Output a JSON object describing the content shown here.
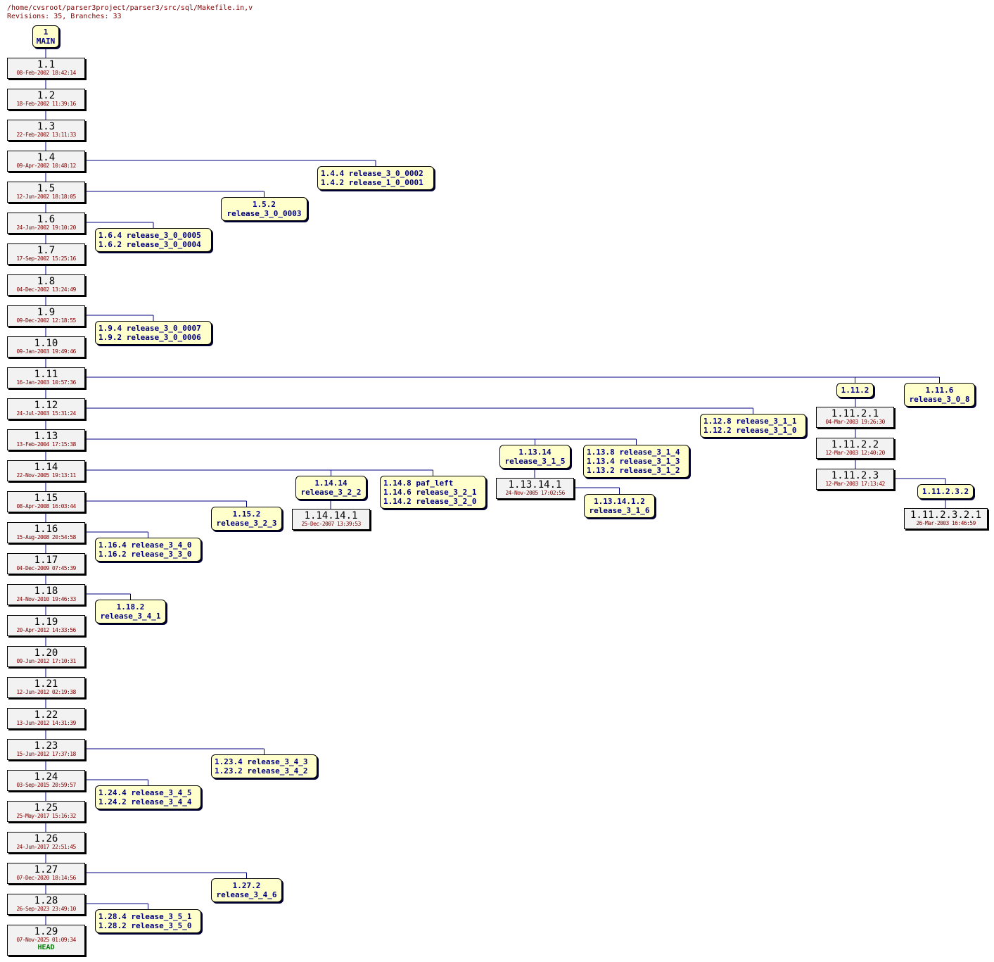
{
  "header": {
    "path": "/home/cvsroot/parser3project/parser3/src/sql/Makefile.in,v",
    "summary": "Revisions: 35, Branches: 33"
  },
  "colors": {
    "line": "#000080",
    "branch_bg": "#ffffcc",
    "branch_text": "#000080",
    "rev_bg": "#f2f2f2",
    "date": "#800000",
    "head": "#008000"
  },
  "root": {
    "num": "1",
    "name": "MAIN"
  },
  "revisions": [
    {
      "num": "1.1",
      "date": "08-Feb-2002 18:42:14"
    },
    {
      "num": "1.2",
      "date": "18-Feb-2002 11:39:16"
    },
    {
      "num": "1.3",
      "date": "22-Feb-2002 13:11:33"
    },
    {
      "num": "1.4",
      "date": "09-Apr-2002 10:48:12"
    },
    {
      "num": "1.5",
      "date": "12-Jun-2002 18:18:05"
    },
    {
      "num": "1.6",
      "date": "24-Jun-2002 19:10:20"
    },
    {
      "num": "1.7",
      "date": "17-Sep-2002 15:25:16"
    },
    {
      "num": "1.8",
      "date": "04-Dec-2002 13:24:49"
    },
    {
      "num": "1.9",
      "date": "09-Dec-2002 12:18:55"
    },
    {
      "num": "1.10",
      "date": "09-Jan-2003 19:49:46"
    },
    {
      "num": "1.11",
      "date": "16-Jan-2003 10:57:36"
    },
    {
      "num": "1.12",
      "date": "24-Jul-2003 15:31:24"
    },
    {
      "num": "1.13",
      "date": "13-Feb-2004 17:15:38"
    },
    {
      "num": "1.14",
      "date": "22-Nov-2005 19:13:11"
    },
    {
      "num": "1.15",
      "date": "08-Apr-2008 16:03:44"
    },
    {
      "num": "1.16",
      "date": "15-Aug-2008 20:54:58"
    },
    {
      "num": "1.17",
      "date": "04-Dec-2009 07:45:39"
    },
    {
      "num": "1.18",
      "date": "24-Nov-2010 19:46:33"
    },
    {
      "num": "1.19",
      "date": "20-Apr-2012 14:33:56"
    },
    {
      "num": "1.20",
      "date": "09-Jun-2012 17:10:31"
    },
    {
      "num": "1.21",
      "date": "12-Jun-2012 02:19:38"
    },
    {
      "num": "1.22",
      "date": "13-Jun-2012 14:31:39"
    },
    {
      "num": "1.23",
      "date": "15-Jun-2012 17:37:18"
    },
    {
      "num": "1.24",
      "date": "03-Sep-2015 20:59:57"
    },
    {
      "num": "1.25",
      "date": "25-May-2017 15:16:32"
    },
    {
      "num": "1.26",
      "date": "24-Jun-2017 22:51:45"
    },
    {
      "num": "1.27",
      "date": "07-Dec-2020 18:14:56"
    },
    {
      "num": "1.28",
      "date": "26-Sep-2023 23:49:10"
    },
    {
      "num": "1.29",
      "date": "07-Nov-2025 01:09:34",
      "tag": "HEAD"
    }
  ],
  "branches": [
    {
      "from": "1.4",
      "lines": [
        "1.4.4 release_3_0_0002",
        "1.4.2 release_1_0_0001"
      ]
    },
    {
      "from": "1.5",
      "lines": [
        "1.5.2",
        "release_3_0_0003"
      ]
    },
    {
      "from": "1.6",
      "lines": [
        "1.6.4 release_3_0_0005",
        "1.6.2 release_3_0_0004"
      ]
    },
    {
      "from": "1.9",
      "lines": [
        "1.9.4 release_3_0_0007",
        "1.9.2 release_3_0_0006"
      ]
    },
    {
      "from": "1.11",
      "lines": [
        "1.11.2"
      ]
    },
    {
      "from": "1.11",
      "lines": [
        "1.11.6",
        "release_3_0_8"
      ]
    },
    {
      "from": "1.12",
      "lines": [
        "1.12.8 release_3_1_1",
        "1.12.2 release_3_1_0"
      ]
    },
    {
      "from": "1.13",
      "lines": [
        "1.13.14",
        "release_3_1_5"
      ]
    },
    {
      "from": "1.13",
      "lines": [
        "1.13.8 release_3_1_4",
        "1.13.4 release_3_1_3",
        "1.13.2 release_3_1_2"
      ]
    },
    {
      "from": "1.14",
      "lines": [
        "1.14.14",
        "release_3_2_2"
      ]
    },
    {
      "from": "1.14",
      "lines": [
        "1.14.8 paf_left",
        "1.14.6 release_3_2_1",
        "1.14.2 release_3_2_0"
      ]
    },
    {
      "from": "1.15",
      "lines": [
        "1.15.2",
        "release_3_2_3"
      ]
    },
    {
      "from": "1.16",
      "lines": [
        "1.16.4 release_3_4_0",
        "1.16.2 release_3_3_0"
      ]
    },
    {
      "from": "1.18",
      "lines": [
        "1.18.2",
        "release_3_4_1"
      ]
    },
    {
      "from": "1.23",
      "lines": [
        "1.23.4 release_3_4_3",
        "1.23.2 release_3_4_2"
      ]
    },
    {
      "from": "1.24",
      "lines": [
        "1.24.4 release_3_4_5",
        "1.24.2 release_3_4_4"
      ]
    },
    {
      "from": "1.27",
      "lines": [
        "1.27.2",
        "release_3_4_6"
      ]
    },
    {
      "from": "1.28",
      "lines": [
        "1.28.4 release_3_5_1",
        "1.28.2 release_3_5_0"
      ]
    },
    {
      "from": "1.13.14.1",
      "lines": [
        "1.13.14.1.2",
        "release_3_1_6"
      ]
    },
    {
      "from": "1.11.2.3",
      "lines": [
        "1.11.2.3.2"
      ]
    }
  ],
  "branch_revisions": [
    {
      "num": "1.11.2.1",
      "date": "04-Mar-2003 19:26:30"
    },
    {
      "num": "1.11.2.2",
      "date": "12-Mar-2003 12:40:20"
    },
    {
      "num": "1.11.2.3",
      "date": "12-Mar-2003 17:13:42"
    },
    {
      "num": "1.11.2.3.2.1",
      "date": "26-Mar-2003 16:46:59"
    },
    {
      "num": "1.13.14.1",
      "date": "24-Nov-2005 17:02:56"
    },
    {
      "num": "1.14.14.1",
      "date": "25-Dec-2007 13:39:53"
    }
  ]
}
